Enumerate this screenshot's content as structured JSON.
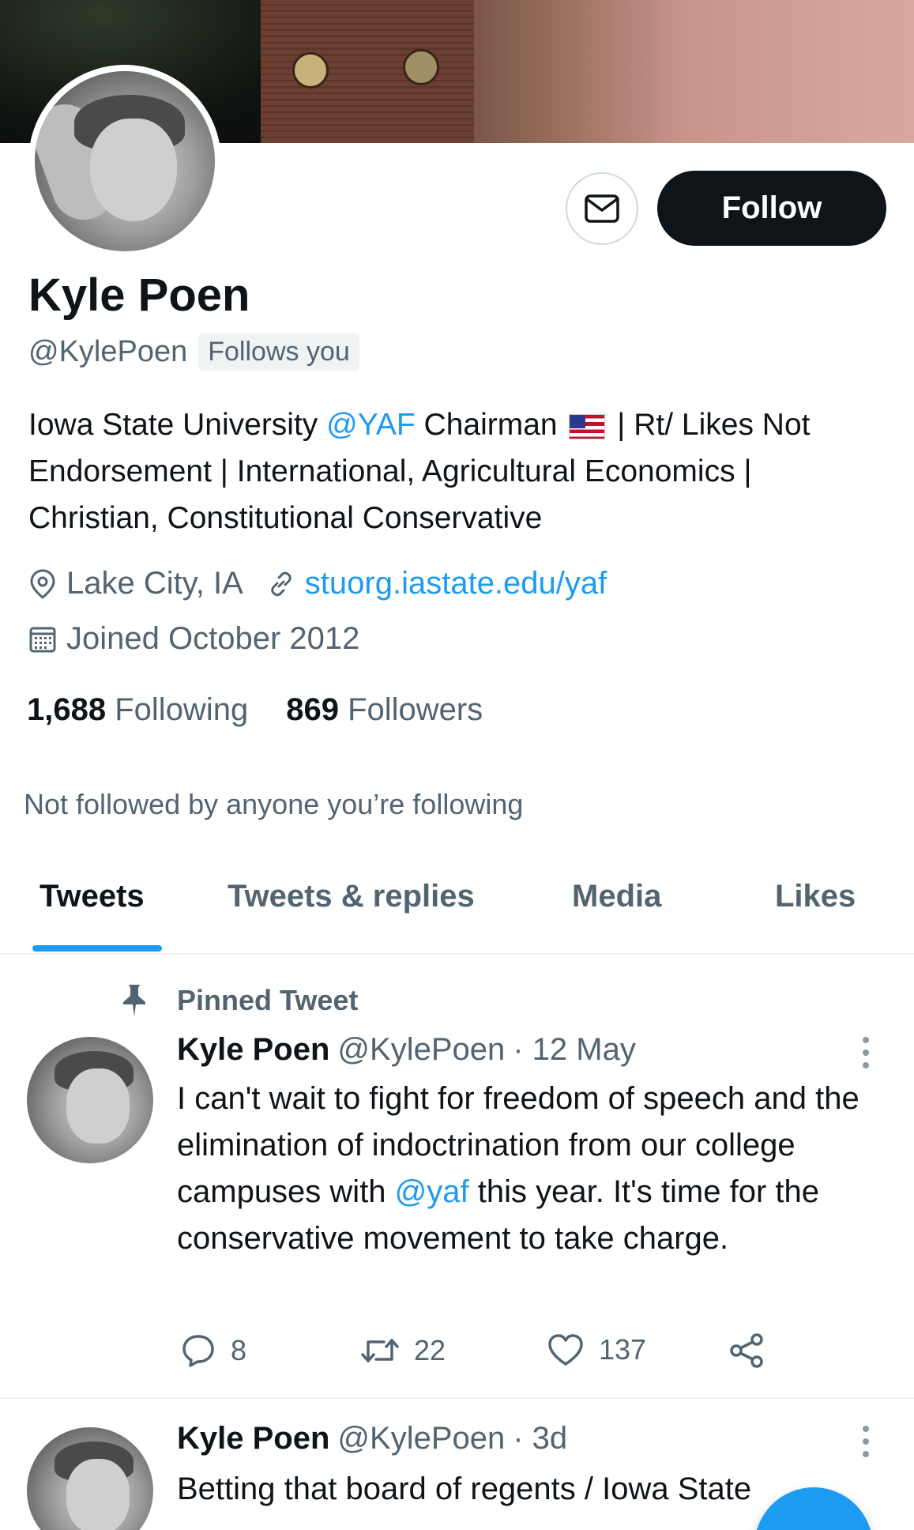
{
  "profile": {
    "name": "Kyle Poen",
    "handle": "@KylePoen",
    "follows_you": "Follows you",
    "bio": {
      "part1": "Iowa State University ",
      "mention": "@YAF",
      "part2": " Chairman ",
      "part3": " | Rt/ Likes Not Endorsement | International, Agricultural Economics | Christian, Constitutional Conservative"
    },
    "location": "Lake City, IA",
    "website": "stuorg.iastate.edu/yaf",
    "joined": "Joined October 2012",
    "following_count": "1,688",
    "following_label": "Following",
    "followers_count": "869",
    "followers_label": "Followers",
    "not_followed": "Not followed by anyone you’re following"
  },
  "actions": {
    "follow_label": "Follow",
    "message_icon": "envelope-icon"
  },
  "tabs": [
    {
      "label": "Tweets",
      "active": true
    },
    {
      "label": "Tweets & replies",
      "active": false
    },
    {
      "label": "Media",
      "active": false
    },
    {
      "label": "Likes",
      "active": false
    }
  ],
  "tweets": [
    {
      "pinned_label": "Pinned Tweet",
      "name": "Kyle Poen",
      "handle": "@KylePoen",
      "time": "· 12 May",
      "text_part1": "I can't wait to fight for freedom of speech and the elimination of indoctrination from our college campuses with ",
      "mention": "@yaf",
      "text_part2": " this year.  It's time for the conservative movement to take charge.",
      "replies": "8",
      "retweets": "22",
      "likes": "137"
    },
    {
      "name": "Kyle Poen",
      "handle": "@KylePoen",
      "time": "· 3d",
      "text": "Betting that board of regents / Iowa State"
    }
  ],
  "colors": {
    "accent": "#1d9bf0",
    "text_primary": "#0f1419",
    "text_secondary": "#536471",
    "follow_bg": "#0f1419"
  }
}
